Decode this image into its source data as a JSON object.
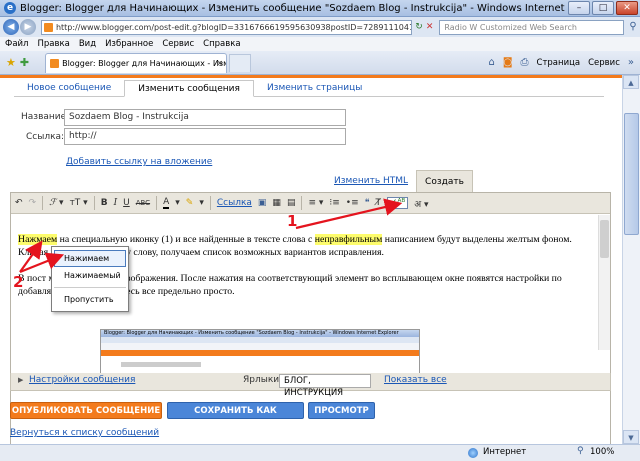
{
  "window": {
    "title": "Blogger: Blogger для Начинающих - Изменить сообщение \"Sozdaem Blog - Instrukcija\" - Windows Internet Explorer",
    "minimize": "–",
    "maximize": "□",
    "close": "✕"
  },
  "address": {
    "url": "http://www.blogger.com/post-edit.g?blogID=3316766619595630938postID=7289111041063277666",
    "search_placeholder": "Radio W Customized Web Search"
  },
  "menu": [
    "Файл",
    "Правка",
    "Вид",
    "Избранное",
    "Сервис",
    "Справка"
  ],
  "tab": {
    "label": "Blogger: Blogger для Начинающих - Изменить сообще...",
    "close": "✕"
  },
  "toolbar_right": {
    "page": "Страница",
    "tools": "Сервис"
  },
  "page_tabs": [
    "Новое сообщение",
    "Изменить сообщения",
    "Изменить страницы"
  ],
  "form": {
    "title_label": "Название:",
    "title_value": "Sozdaem Blog - Instrukcija",
    "link_label": "Ссылка:",
    "link_value": "http://",
    "add_enclosure": "Добавить ссылку на вложение"
  },
  "mode_tabs": {
    "html": "Изменить HTML",
    "compose": "Создать"
  },
  "editor_toolbar": {
    "link_label": "Ссылка"
  },
  "editor_text": {
    "p1_hl1": "Нажмаем",
    "p1_a": " на специальную иконку (1) и все найденные в тексте слова с ",
    "p1_hl2": "неправфильным",
    "p1_b": "написанием будут выделены желтым фоном.  Кликая по каждому такому слову, получаем список возможных вариантов исправления.",
    "p2": "В пост можно вставлять изображения. После нажатия на соответствующий элемент во всплывающем окне появятся настройки по добавляемой картинке. Здесь все предельно просто."
  },
  "embedded_image_title": "Blogger: Blogger для Начинающих - Изменить сообщение \"Sozdaem Blog - Instrukcija\" - Windows Internet Explorer",
  "context_menu": [
    "Нажимаем",
    "Нажимаемый",
    "Пропустить"
  ],
  "labels_row": {
    "settings": "Настройки сообщения",
    "labels_label": "Ярлыки:",
    "labels_value": "БЛОГ, ИНСТРУКЦИЯ",
    "show_all": "Показать все"
  },
  "buttons": {
    "publish": "ОПУБЛИКОВАТЬ СООБЩЕНИЕ",
    "save_draft": "СОХРАНИТЬ КАК ЧЕРНОВИК",
    "preview": "ПРОСМОТР"
  },
  "back_link": "Вернуться к списку сообщений",
  "status": {
    "zone": "Интернет",
    "zoom": "100%"
  },
  "annotations": [
    "1",
    "2"
  ],
  "colors": {
    "accent_orange": "#f37b1d",
    "button_blue": "#4b86d8",
    "highlight_yellow": "#fdfc6c",
    "annotation_red": "#e4141e"
  }
}
